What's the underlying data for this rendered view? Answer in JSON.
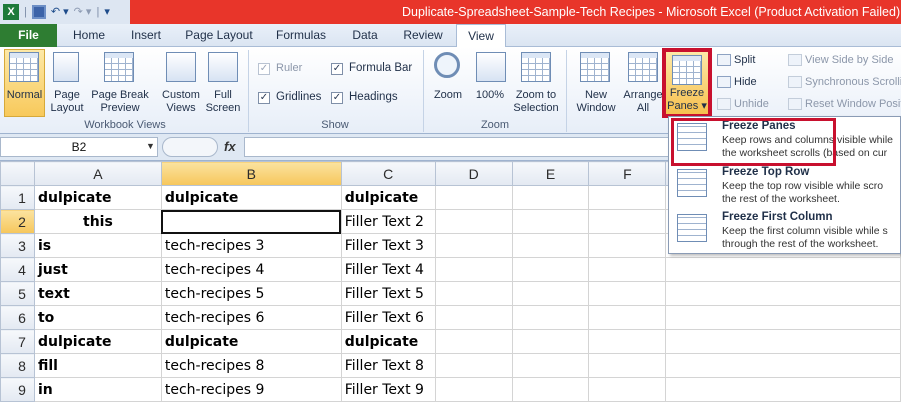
{
  "titlebar": {
    "title": "Duplicate-Spreadsheet-Sample-Tech Recipes  -  Microsoft Excel (Product Activation Failed)",
    "logo": "X",
    "icons": [
      "excel-logo-icon",
      "save-icon",
      "undo-icon",
      "redo-icon",
      "customize-qat-icon"
    ]
  },
  "tabs": {
    "file": "File",
    "home": "Home",
    "insert": "Insert",
    "page_layout": "Page Layout",
    "formulas": "Formulas",
    "data": "Data",
    "review": "Review",
    "view": "View"
  },
  "ribbon": {
    "workbook_views": {
      "label": "Workbook Views",
      "normal": "Normal",
      "page_layout_1": "Page",
      "page_layout_2": "Layout",
      "page_break_1": "Page Break",
      "page_break_2": "Preview",
      "custom_1": "Custom",
      "custom_2": "Views",
      "full_1": "Full",
      "full_2": "Screen"
    },
    "show": {
      "label": "Show",
      "ruler": "Ruler",
      "formula_bar": "Formula Bar",
      "gridlines": "Gridlines",
      "headings": "Headings"
    },
    "zoom": {
      "label": "Zoom",
      "zoom": "Zoom",
      "hundred": "100%",
      "to_selection_1": "Zoom to",
      "to_selection_2": "Selection"
    },
    "window": {
      "new_window_1": "New",
      "new_window_2": "Window",
      "arrange_1": "Arrange",
      "arrange_2": "All",
      "freeze_1": "Freeze",
      "freeze_2": "Panes ▾",
      "split": "Split",
      "hide": "Hide",
      "unhide": "Unhide",
      "side_by_side": "View Side by Side",
      "sync_scroll": "Synchronous Scrolling",
      "reset_window": "Reset Window Position"
    }
  },
  "formula_bar": {
    "name_box": "B2",
    "fx": "fx",
    "value": ""
  },
  "sheet": {
    "columns": [
      "A",
      "B",
      "C",
      "D",
      "E",
      "F"
    ],
    "rows": [
      {
        "num": "1",
        "a": "dulpicate",
        "b": "dulpicate",
        "c": "dulpicate"
      },
      {
        "num": "2",
        "a": "this",
        "b": "",
        "c": "Filler Text 2"
      },
      {
        "num": "3",
        "a": "is",
        "b": "tech-recipes  3",
        "c": "Filler Text 3"
      },
      {
        "num": "4",
        "a": "just",
        "b": "tech-recipes 4",
        "c": "Filler Text 4"
      },
      {
        "num": "5",
        "a": "text",
        "b": "tech-recipes  5",
        "c": "Filler Text 5"
      },
      {
        "num": "6",
        "a": "to",
        "b": "tech-recipes  6",
        "c": "Filler Text 6"
      },
      {
        "num": "7",
        "a": "dulpicate",
        "b": "dulpicate",
        "c": "dulpicate"
      },
      {
        "num": "8",
        "a": "fill",
        "b": "tech-recipes  8",
        "c": "Filler Text 8"
      },
      {
        "num": "9",
        "a": "in",
        "b": "tech-recipes 9",
        "c": "Filler Text 9"
      }
    ]
  },
  "freeze_menu": {
    "items": [
      {
        "title": "Freeze Panes",
        "desc1": "Keep rows and columns visible while",
        "desc2": "the worksheet scrolls (based on cur"
      },
      {
        "title": "Freeze Top Row",
        "desc1": "Keep the top row visible while scro",
        "desc2": "the rest of the worksheet."
      },
      {
        "title": "Freeze First Column",
        "desc1": "Keep the first column visible while s",
        "desc2": "through the rest of the worksheet."
      }
    ]
  }
}
